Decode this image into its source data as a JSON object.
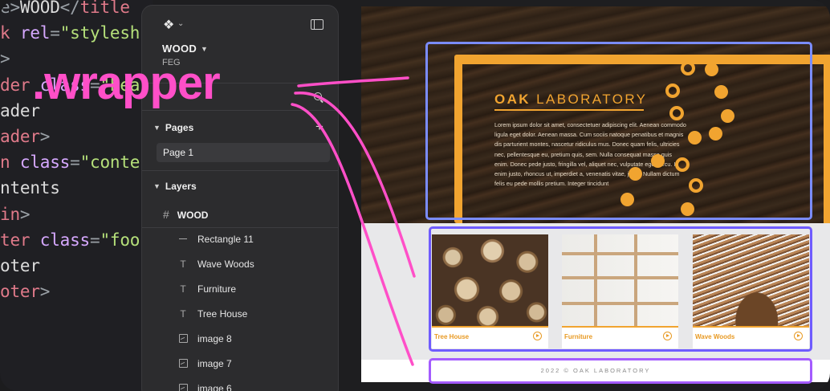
{
  "code_editor": {
    "lines": [
      {
        "parts": [
          [
            "e>",
            "punc"
          ],
          [
            "WOOD",
            "text"
          ],
          [
            "</",
            "punc"
          ],
          [
            "title",
            "tag"
          ]
        ]
      },
      {
        "parts": [
          [
            "k ",
            "tag"
          ],
          [
            "rel",
            "attr"
          ],
          [
            "=",
            "punc"
          ],
          [
            "\"stylesh",
            "str"
          ]
        ]
      },
      {
        "parts": [
          [
            ">",
            "punc"
          ]
        ]
      },
      {
        "parts": [
          [
            "der ",
            "tag"
          ],
          [
            "class",
            "attr"
          ],
          [
            "=",
            "punc"
          ],
          [
            "\"hea",
            "str"
          ]
        ]
      },
      {
        "parts": [
          [
            "ader",
            "text"
          ]
        ]
      },
      {
        "parts": [
          [
            "ader",
            "tag"
          ],
          [
            ">",
            "punc"
          ]
        ]
      },
      {
        "parts": [
          [
            "n ",
            "tag"
          ],
          [
            "class",
            "attr"
          ],
          [
            "=",
            "punc"
          ],
          [
            "\"conte",
            "str"
          ]
        ]
      },
      {
        "parts": [
          [
            "ntents",
            "text"
          ]
        ]
      },
      {
        "parts": [
          [
            "in",
            "tag"
          ],
          [
            ">",
            "punc"
          ]
        ]
      },
      {
        "parts": [
          [
            "ter ",
            "tag"
          ],
          [
            "class",
            "attr"
          ],
          [
            "=",
            "punc"
          ],
          [
            "\"foo",
            "str"
          ]
        ]
      },
      {
        "parts": [
          [
            "oter",
            "text"
          ]
        ]
      },
      {
        "parts": [
          [
            "oter",
            "tag"
          ],
          [
            ">",
            "punc"
          ]
        ]
      }
    ]
  },
  "layers_panel": {
    "file_name": "WOOD",
    "team_name": "FEG",
    "pages_header": "Pages",
    "pages": [
      "Page 1"
    ],
    "layers_header": "Layers",
    "frame_name": "WOOD",
    "layers": [
      {
        "name": "Rectangle 11",
        "icon": "rectangle-icon"
      },
      {
        "name": "Wave Woods",
        "icon": "text-icon"
      },
      {
        "name": "Furniture",
        "icon": "text-icon"
      },
      {
        "name": "Tree House",
        "icon": "text-icon"
      },
      {
        "name": "image 8",
        "icon": "image-icon"
      },
      {
        "name": "image 7",
        "icon": "image-icon"
      },
      {
        "name": "image 6",
        "icon": "image-icon"
      }
    ]
  },
  "annotation": {
    "label": ".wrapper",
    "color": "#ff4fc8"
  },
  "preview": {
    "hero_title_bold": "OAK",
    "hero_title_rest": " LABORATORY",
    "hero_body": "Lorem ipsum dolor sit amet, consectetuer adipiscing elit. Aenean commodo ligula eget dolor. Aenean massa. Cum sociis natoque penatibus et magnis dis parturient montes, nascetur ridiculus mus. Donec quam felis, ultricies nec, pellentesque eu, pretium quis, sem. Nulla consequat massa quis enim. Donec pede justo, fringilla vel, aliquet nec, vulputate eget, arcu. In enim justo, rhoncus ut, imperdiet a, venenatis vitae, justo. Nullam dictum felis eu pede mollis pretium. Integer tincidunt",
    "cards": [
      {
        "label": "Tree House"
      },
      {
        "label": "Furniture"
      },
      {
        "label": "Wave Woods"
      }
    ],
    "footer": "2022 © OAK LABORATORY",
    "accent": "#f1a430",
    "selection_color": "#6f5bff"
  }
}
